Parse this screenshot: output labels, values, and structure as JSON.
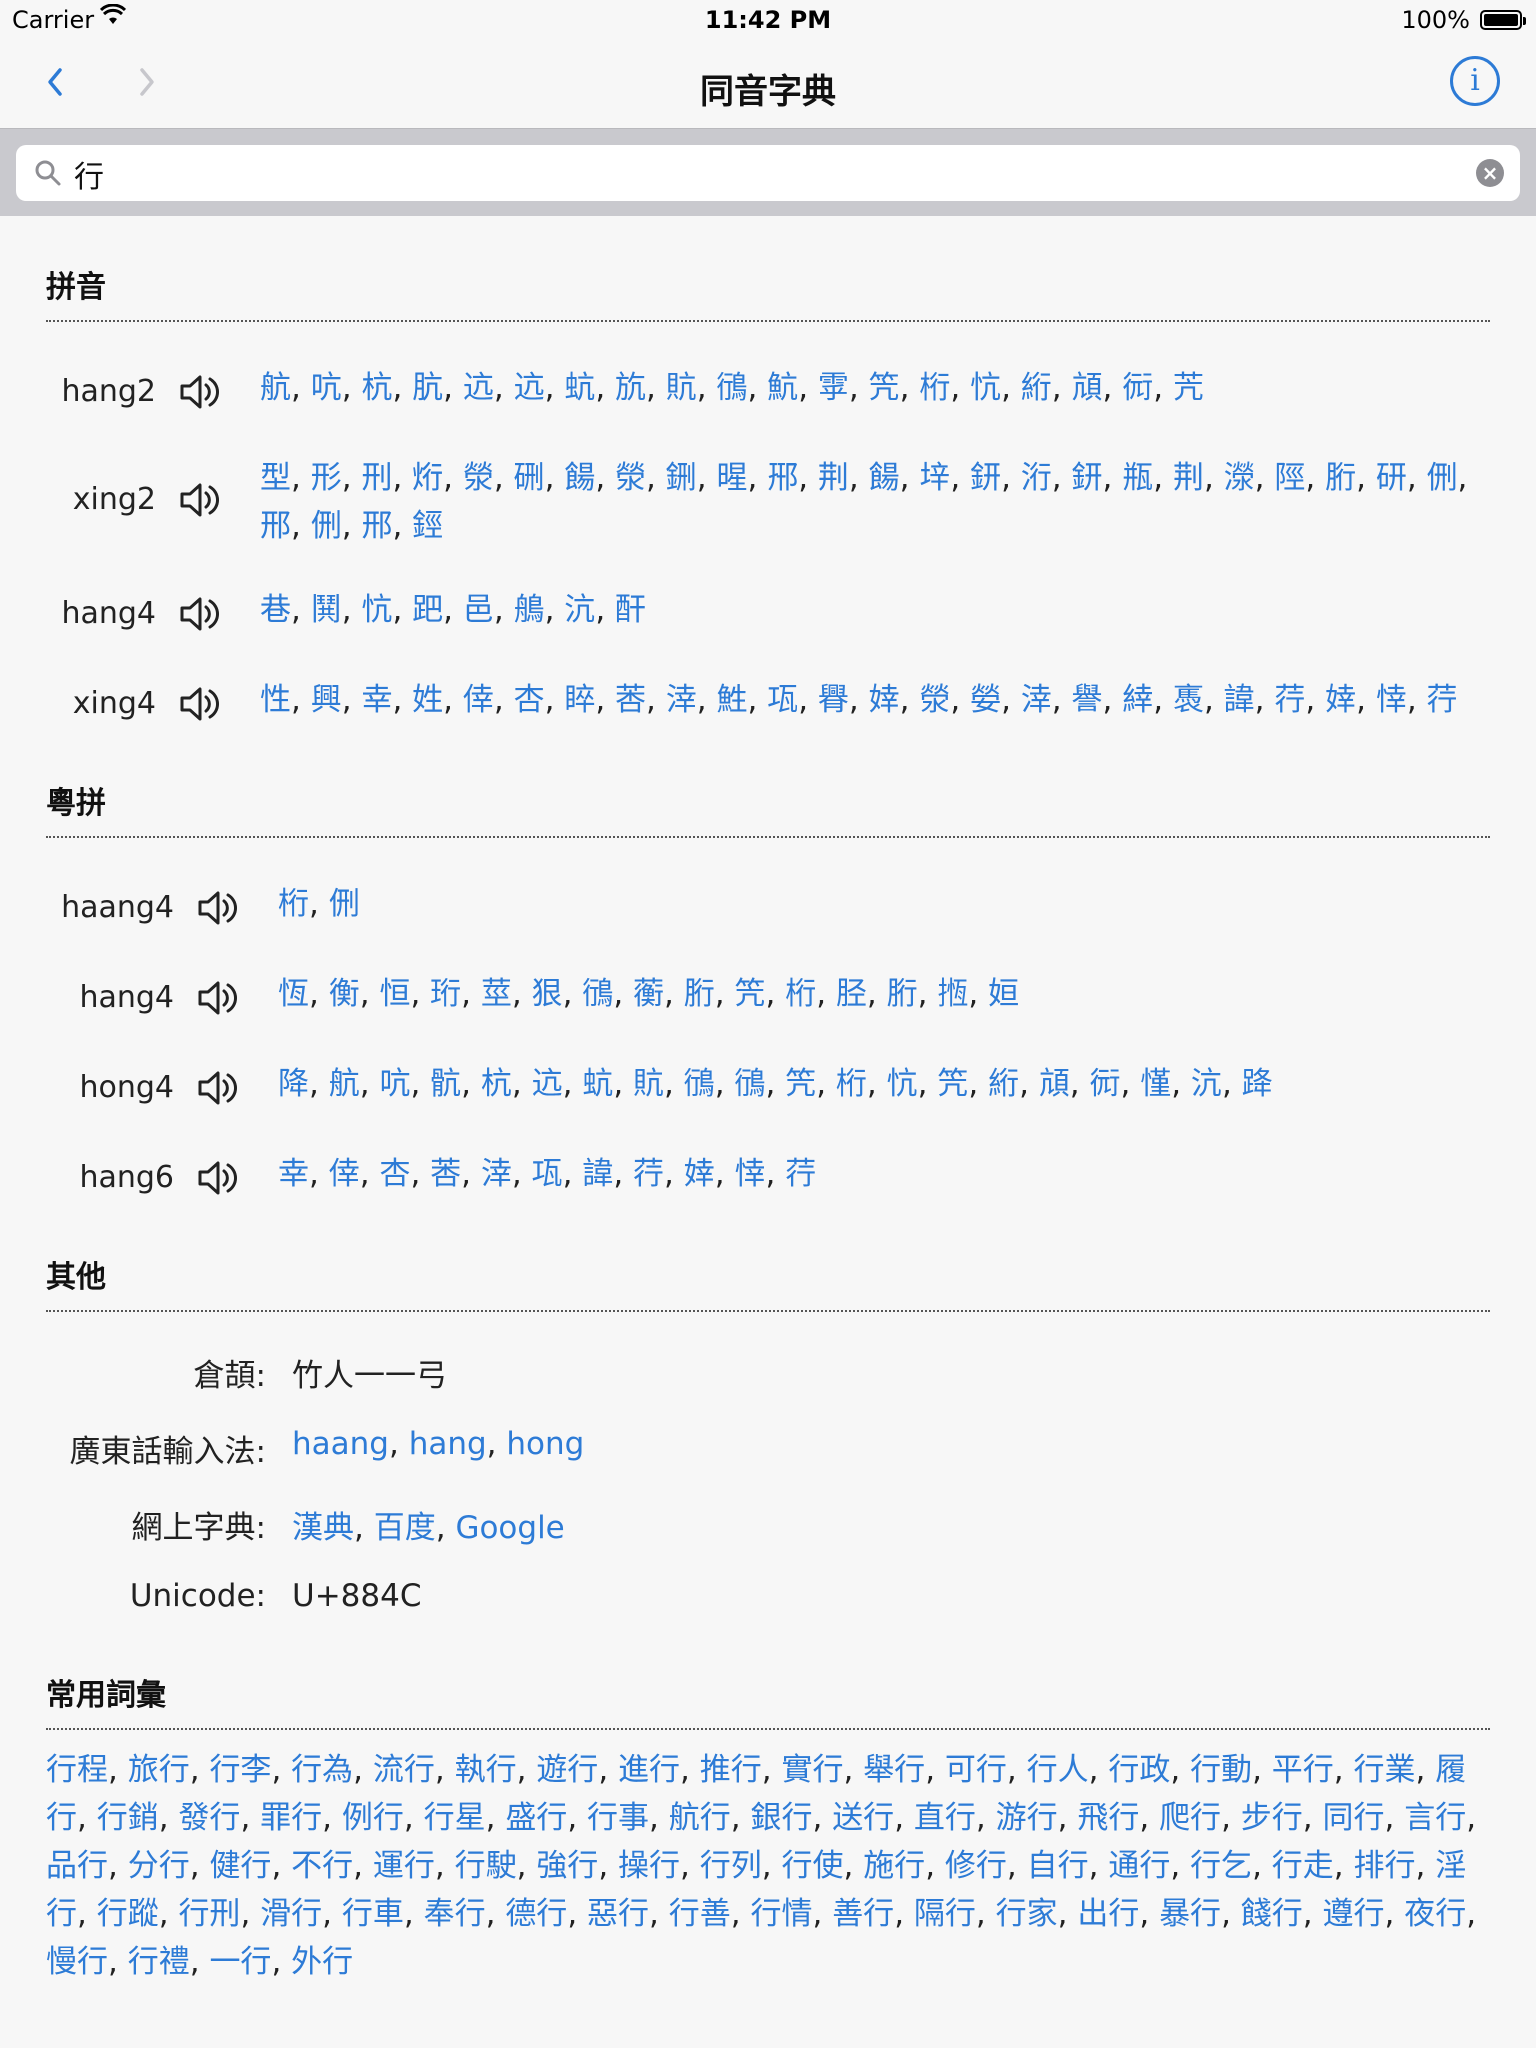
{
  "status_bar": {
    "carrier": "Carrier",
    "time": "11:42 PM",
    "battery": "100%"
  },
  "nav": {
    "title": "同音字典"
  },
  "search": {
    "value": "行",
    "placeholder": ""
  },
  "pinyin": {
    "header": "拼音",
    "rows": [
      {
        "rom": "hang2",
        "chars": [
          "航",
          "吭",
          "杭",
          "肮",
          "迒",
          "迒",
          "蚢",
          "斻",
          "貥",
          "鴴",
          "魧",
          "雽",
          "笐",
          "桁",
          "忼",
          "絎",
          "頏",
          "衏",
          "苀"
        ]
      },
      {
        "rom": "xing2",
        "chars": [
          "型",
          "形",
          "刑",
          "烆",
          "滎",
          "硎",
          "餳",
          "滎",
          "鉶",
          "暒",
          "郉",
          "荆",
          "餳",
          "垶",
          "鈃",
          "洐",
          "鈃",
          "瓶",
          "荆",
          "濴",
          "陘",
          "胻",
          "研",
          "侀",
          "邢",
          "侀",
          "邢",
          "鋞"
        ]
      },
      {
        "rom": "hang4",
        "chars": [
          "巷",
          "鬨",
          "忼",
          "跁",
          "邑",
          "鵃",
          "沆",
          "酐"
        ]
      },
      {
        "rom": "xing4",
        "chars": [
          "性",
          "興",
          "幸",
          "姓",
          "倖",
          "杏",
          "睟",
          "莕",
          "涬",
          "鮏",
          "瓨",
          "臖",
          "婞",
          "滎",
          "嫈",
          "涬",
          "譽",
          "緈",
          "褭",
          "諱",
          "荇",
          "婞",
          "悻",
          "荇"
        ]
      }
    ]
  },
  "jyutping": {
    "header": "粵拼",
    "rows": [
      {
        "rom": "haang4",
        "chars": [
          "桁",
          "侀"
        ]
      },
      {
        "rom": "hang4",
        "chars": [
          "恆",
          "衡",
          "恒",
          "珩",
          "莖",
          "狠",
          "鴴",
          "蘅",
          "胻",
          "笐",
          "桁",
          "胫",
          "胻",
          "揯",
          "姮"
        ]
      },
      {
        "rom": "hong4",
        "chars": [
          "降",
          "航",
          "吭",
          "骯",
          "杭",
          "迒",
          "蚢",
          "貥",
          "鴴",
          "鴴",
          "笐",
          "桁",
          "忼",
          "笐",
          "絎",
          "頏",
          "衏",
          "慬",
          "沆",
          "跭"
        ]
      },
      {
        "rom": "hang6",
        "chars": [
          "幸",
          "倖",
          "杏",
          "莕",
          "涬",
          "瓨",
          "諱",
          "荇",
          "婞",
          "悻",
          "荇"
        ]
      }
    ]
  },
  "other": {
    "header": "其他",
    "cangjie_label": "倉頡:",
    "cangjie_value": "竹人一一弓",
    "cantonese_input_label": "廣東話輸入法:",
    "cantonese_input_values": [
      "haang",
      "hang",
      "hong"
    ],
    "online_dict_label": "網上字典:",
    "online_dict_values": [
      "漢典",
      "百度",
      "Google"
    ],
    "unicode_label": "Unicode:",
    "unicode_value": "U+884C"
  },
  "vocab": {
    "header": "常用詞彙",
    "words": [
      "行程",
      "旅行",
      "行李",
      "行為",
      "流行",
      "執行",
      "遊行",
      "進行",
      "推行",
      "實行",
      "舉行",
      "可行",
      "行人",
      "行政",
      "行動",
      "平行",
      "行業",
      "履行",
      "行銷",
      "發行",
      "罪行",
      "例行",
      "行星",
      "盛行",
      "行事",
      "航行",
      "銀行",
      "送行",
      "直行",
      "游行",
      "飛行",
      "爬行",
      "步行",
      "同行",
      "言行",
      "品行",
      "分行",
      "健行",
      "不行",
      "運行",
      "行駛",
      "強行",
      "操行",
      "行列",
      "行使",
      "施行",
      "修行",
      "自行",
      "通行",
      "行乞",
      "行走",
      "排行",
      "淫行",
      "行蹤",
      "行刑",
      "滑行",
      "行車",
      "奉行",
      "德行",
      "惡行",
      "行善",
      "行情",
      "善行",
      "隔行",
      "行家",
      "出行",
      "暴行",
      "餞行",
      "遵行",
      "夜行",
      "慢行",
      "行禮",
      "一行",
      "外行"
    ]
  }
}
